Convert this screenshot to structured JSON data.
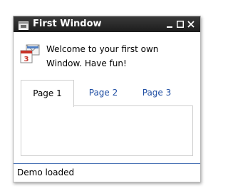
{
  "window": {
    "title": "First Window",
    "title_icon": "window-app-icon",
    "controls": {
      "minimize": "minimize-icon",
      "maximize": "maximize-icon",
      "close": "close-icon"
    },
    "colors": {
      "titlebar": "#2a2a2a",
      "tab_link": "#1f4ea3",
      "status_border": "#4a73b5"
    }
  },
  "content": {
    "welcome_icon": "calendar-mail-icon",
    "welcome_text": "Welcome to your first own Window. Have fun!"
  },
  "tabs": [
    {
      "label": "Page 1",
      "active": true
    },
    {
      "label": "Page 2",
      "active": false
    },
    {
      "label": "Page 3",
      "active": false
    }
  ],
  "statusbar": {
    "text": "Demo loaded"
  }
}
